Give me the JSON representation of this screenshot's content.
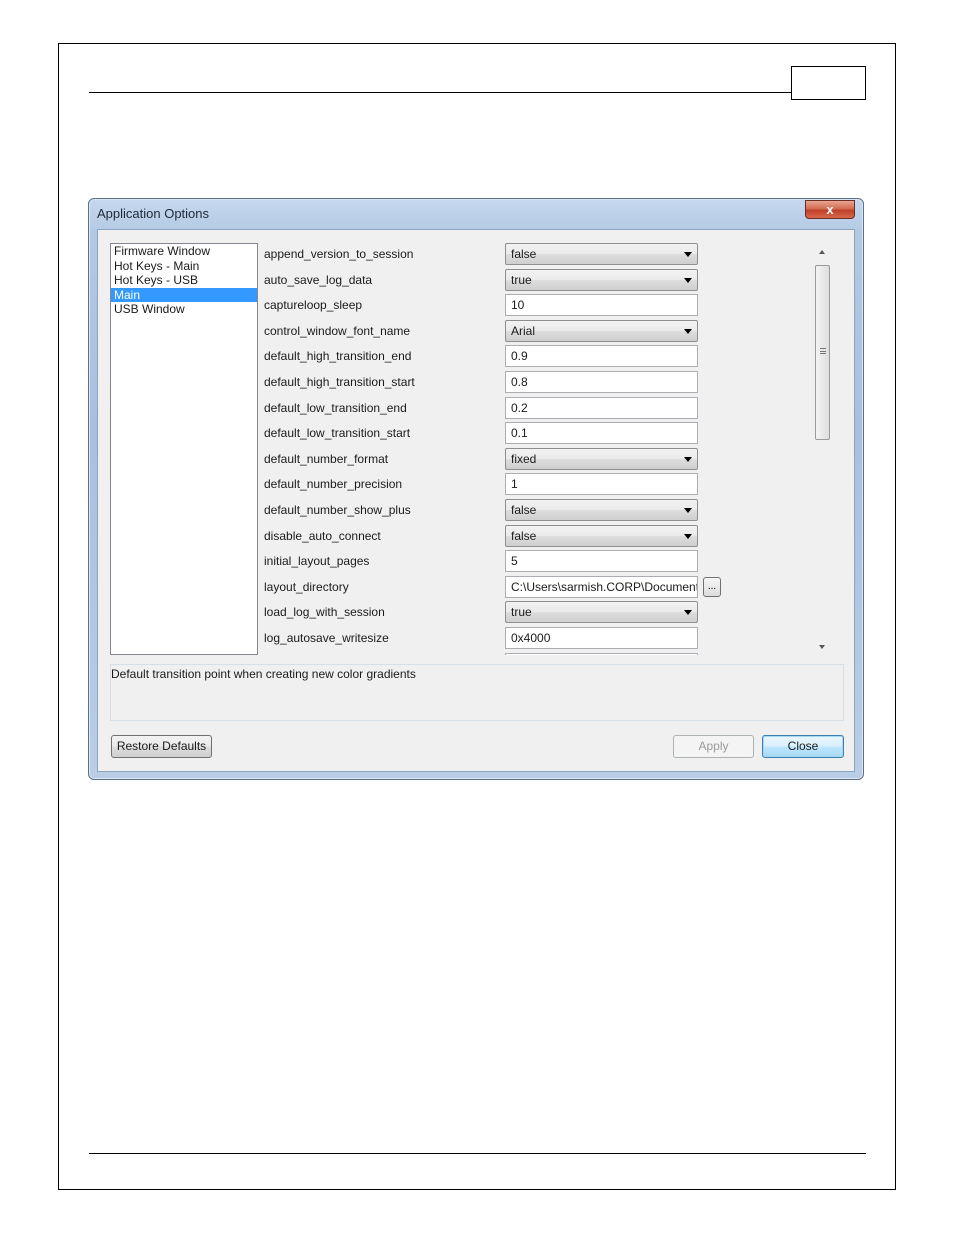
{
  "page": {
    "page_number": ""
  },
  "dialog": {
    "title": "Application Options",
    "close_label": "x",
    "categories": [
      {
        "label": "Firmware Window",
        "selected": false
      },
      {
        "label": "Hot Keys - Main",
        "selected": false
      },
      {
        "label": "Hot Keys - USB",
        "selected": false
      },
      {
        "label": "Main",
        "selected": true
      },
      {
        "label": "USB Window",
        "selected": false
      }
    ],
    "options": [
      {
        "name": "append_version_to_session",
        "value": "false",
        "kind": "combo"
      },
      {
        "name": "auto_save_log_data",
        "value": "true",
        "kind": "combo"
      },
      {
        "name": "captureloop_sleep",
        "value": "10",
        "kind": "text"
      },
      {
        "name": "control_window_font_name",
        "value": "Arial",
        "kind": "combo"
      },
      {
        "name": "default_high_transition_end",
        "value": "0.9",
        "kind": "text"
      },
      {
        "name": "default_high_transition_start",
        "value": "0.8",
        "kind": "text"
      },
      {
        "name": "default_low_transition_end",
        "value": "0.2",
        "kind": "text"
      },
      {
        "name": "default_low_transition_start",
        "value": "0.1",
        "kind": "text"
      },
      {
        "name": "default_number_format",
        "value": "fixed",
        "kind": "combo"
      },
      {
        "name": "default_number_precision",
        "value": "1",
        "kind": "text"
      },
      {
        "name": "default_number_show_plus",
        "value": "false",
        "kind": "combo"
      },
      {
        "name": "disable_auto_connect",
        "value": "false",
        "kind": "combo"
      },
      {
        "name": "initial_layout_pages",
        "value": "5",
        "kind": "text"
      },
      {
        "name": "layout_directory",
        "value": "C:\\Users\\sarmish.CORP\\Documents",
        "kind": "path"
      },
      {
        "name": "load_log_with_session",
        "value": "true",
        "kind": "combo"
      },
      {
        "name": "log_autosave_writesize",
        "value": "0x4000",
        "kind": "text"
      }
    ],
    "browse_label": "...",
    "description": "Default transition point when creating new color gradients",
    "buttons": {
      "restore_defaults": "Restore Defaults",
      "apply": "Apply",
      "close": "Close"
    }
  }
}
